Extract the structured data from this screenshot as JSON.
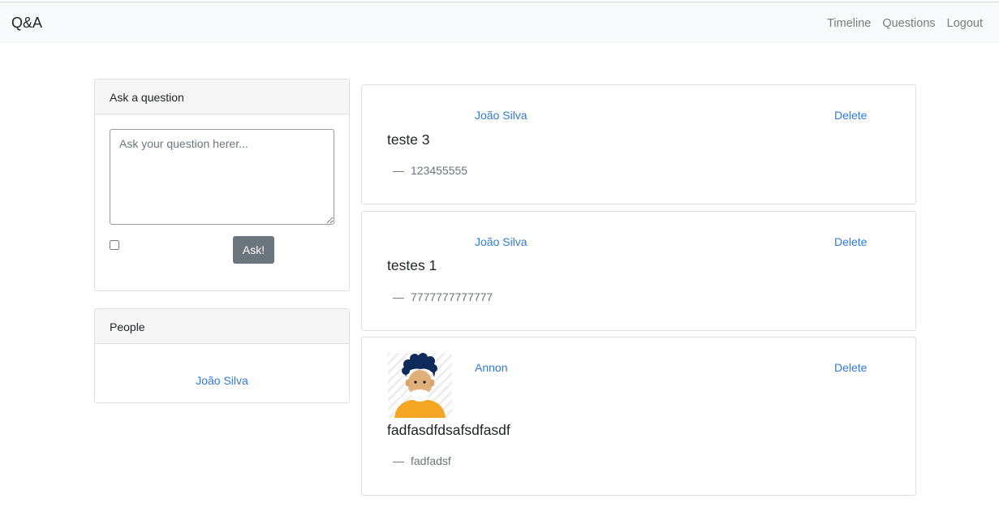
{
  "navbar": {
    "brand": "Q&A",
    "links": [
      "Timeline",
      "Questions",
      "Logout"
    ]
  },
  "ask": {
    "header": "Ask a question",
    "placeholder": "Ask your question herer...",
    "button": "Ask!",
    "anonymous_checked": false
  },
  "people": {
    "header": "People",
    "items": [
      "João Silva"
    ]
  },
  "questions": [
    {
      "author": "João Silva",
      "delete": "Delete",
      "text": "teste 3",
      "answer_dash": "—",
      "answer": "123455555",
      "avatar": false
    },
    {
      "author": "João Silva",
      "delete": "Delete",
      "text": "testes 1",
      "answer_dash": "—",
      "answer": "7777777777777",
      "avatar": false
    },
    {
      "author": "Annon",
      "delete": "Delete",
      "text": "fadfasdfdsafsdfasdf",
      "answer_dash": "—",
      "answer": "fadfadsf",
      "avatar": true,
      "avatar_icon": "masked-person-avatar-icon"
    }
  ],
  "colors": {
    "link": "#2f7ad8",
    "button": "#6c757d",
    "navbar_bg": "#f8f9fa",
    "avatar_hair": "#0d2a5a",
    "avatar_shirt": "#f5a623"
  }
}
